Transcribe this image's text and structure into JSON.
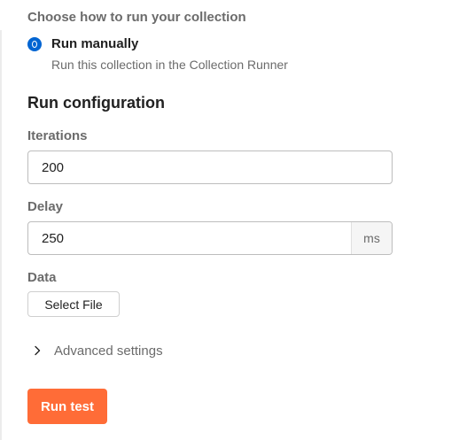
{
  "run_mode": {
    "heading": "Choose how to run your collection",
    "option_label": "Run manually",
    "option_description": "Run this collection in the Collection Runner",
    "selected": true
  },
  "run_configuration": {
    "title": "Run configuration",
    "iterations": {
      "label": "Iterations",
      "value": "200"
    },
    "delay": {
      "label": "Delay",
      "value": "250",
      "unit": "ms"
    },
    "data": {
      "label": "Data",
      "button_label": "Select File"
    },
    "advanced_settings_label": "Advanced settings"
  },
  "actions": {
    "run_button_label": "Run test"
  },
  "colors": {
    "accent_blue": "#0265d2",
    "run_button": "#ff6c37",
    "muted_text": "#6b6b6b"
  },
  "icons": {
    "radio": "radio-selected-icon",
    "advanced_toggle": "chevron-right-icon"
  }
}
